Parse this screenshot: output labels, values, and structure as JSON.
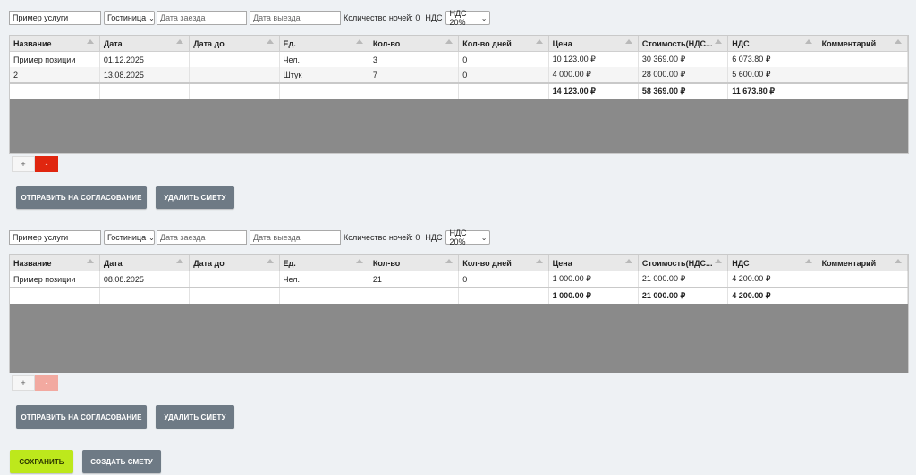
{
  "estimates": [
    {
      "filters": {
        "service": "Пример услуги",
        "type": "Гостиница",
        "checkin_placeholder": "Дата заезда",
        "checkout_placeholder": "Дата выезда",
        "nights_label": "Количество ночей: 0",
        "vat_label": "НДС",
        "vat_value": "НДС 20%"
      },
      "columns": [
        "Название",
        "Дата",
        "Дата до",
        "Ед.",
        "Кол-во",
        "Кол-во дней",
        "Цена",
        "Стоимость(НДС...",
        "НДС",
        "Комментарий"
      ],
      "rows": [
        [
          "Пример позиции",
          "01.12.2025",
          "",
          "Чел.",
          "3",
          "0",
          "10 123.00 ₽",
          "30 369.00 ₽",
          "6 073.80 ₽",
          ""
        ],
        [
          "2",
          "13.08.2025",
          "",
          "Штук",
          "7",
          "0",
          "4 000.00 ₽",
          "28 000.00 ₽",
          "5 600.00 ₽",
          ""
        ]
      ],
      "totals": [
        "",
        "",
        "",
        "",
        "",
        "",
        "14 123.00 ₽",
        "58 369.00 ₽",
        "11 673.80 ₽",
        ""
      ],
      "plus_label": "+",
      "minus_label": "-",
      "minus_enabled": true,
      "send_label": "ОТПРАВИТЬ НА СОГЛАСОВАНИЕ",
      "delete_label": "УДАЛИТЬ СМЕТУ"
    },
    {
      "filters": {
        "service": "Пример услуги",
        "type": "Гостиница",
        "checkin_placeholder": "Дата заезда",
        "checkout_placeholder": "Дата выезда",
        "nights_label": "Количество ночей: 0",
        "vat_label": "НДС",
        "vat_value": "НДС 20%"
      },
      "columns": [
        "Название",
        "Дата",
        "Дата до",
        "Ед.",
        "Кол-во",
        "Кол-во дней",
        "Цена",
        "Стоимость(НДС...",
        "НДС",
        "Комментарий"
      ],
      "rows": [
        [
          "Пример позиции",
          "08.08.2025",
          "",
          "Чел.",
          "21",
          "0",
          "1 000.00 ₽",
          "21 000.00 ₽",
          "4 200.00 ₽",
          ""
        ]
      ],
      "totals": [
        "",
        "",
        "",
        "",
        "",
        "",
        "1 000.00 ₽",
        "21 000.00 ₽",
        "4 200.00 ₽",
        ""
      ],
      "plus_label": "+",
      "minus_label": "-",
      "minus_enabled": false,
      "send_label": "ОТПРАВИТЬ НА СОГЛАСОВАНИЕ",
      "delete_label": "УДАЛИТЬ СМЕТУ"
    }
  ],
  "footer": {
    "save_label": "СОХРАНИТЬ",
    "create_label": "СОЗДАТЬ СМЕТУ"
  },
  "colors": {
    "save_button": "#bde81c",
    "action_button": "#6e7a85",
    "minus_active": "#e0260f",
    "minus_disabled": "#f2a9a0",
    "grid_empty": "#8a8a8a"
  }
}
